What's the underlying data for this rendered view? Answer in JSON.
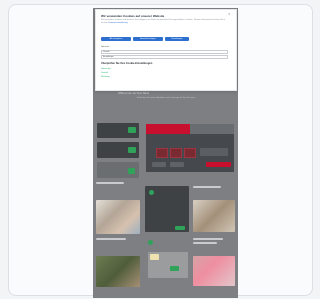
{
  "modal": {
    "title": "Wir verwenden Cookies auf unserer Website",
    "close": "✕",
    "body": "Wir verwenden Cookies und ähnliche Technologien, um Ihnen ein optimales Nutzungserlebnis zu bieten. Weitere Informationen finden Sie in unserer",
    "link": "Datenschutzerklärung",
    "buttons": [
      "Alle akzeptieren",
      "Auswahl bestätigen",
      "Einstellungen"
    ],
    "select_label": "Sprache",
    "select_value": "Deutsch",
    "select2_value": "Einstellungen",
    "heading": "Überprüfen Sie Ihre Cookie-Einstellungen",
    "green_items": [
      "Notwendig",
      "Statistik",
      "Marketing"
    ]
  },
  "page": {
    "section_title": "Willkommen bei Ihrer Bank",
    "section_sub": "Entdecken Sie unsere Angebote und Leistungen für Ihre Finanzen"
  }
}
